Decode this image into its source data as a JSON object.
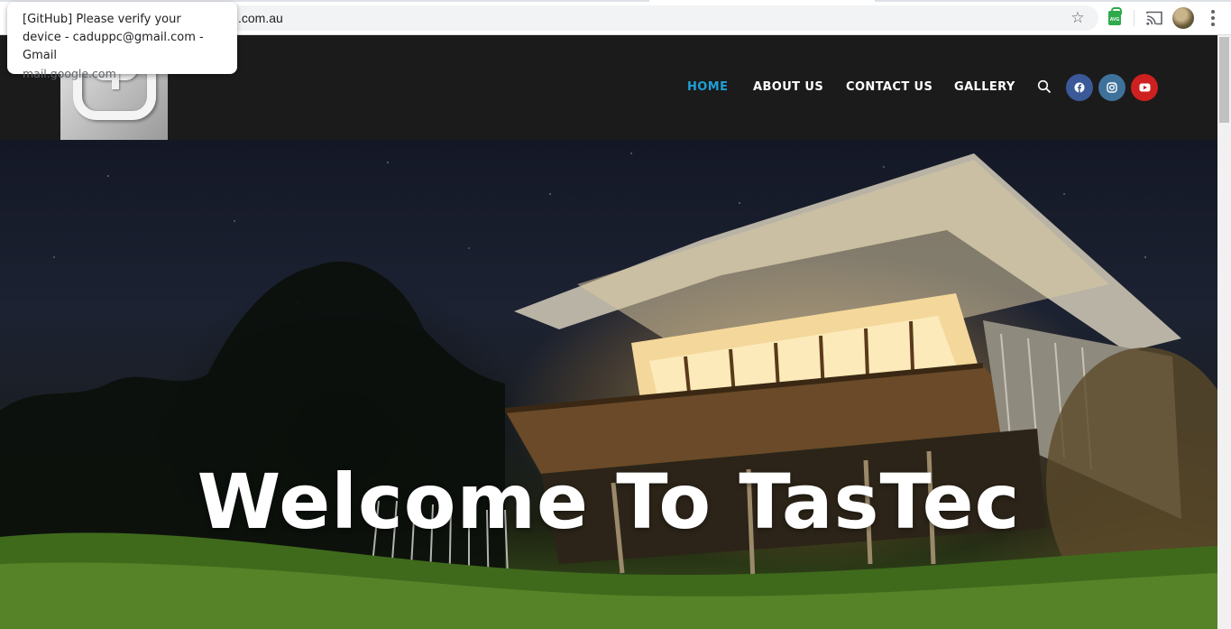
{
  "browser": {
    "url_visible": ".com.au",
    "icons": [
      "star-icon",
      "avg-extension-icon",
      "cast-icon",
      "profile-avatar",
      "menu-icon"
    ]
  },
  "notification": {
    "title": "[GitHub] Please verify your device - caduppc@gmail.com - Gmail",
    "source": "mail.google.com"
  },
  "site": {
    "nav": {
      "home": "HOME",
      "about": "ABOUT US",
      "contact": "CONTACT US",
      "gallery": "GALLERY"
    },
    "colors": {
      "header_bg": "#1b1b1b",
      "active_link": "#1e9fd6",
      "link": "#ffffff",
      "facebook": "#3b5998",
      "instagram": "#3f729b",
      "youtube": "#cd201f"
    },
    "social": [
      "facebook-icon",
      "instagram-icon",
      "youtube-icon"
    ],
    "hero": {
      "title": "Welcome To TasTec"
    }
  }
}
